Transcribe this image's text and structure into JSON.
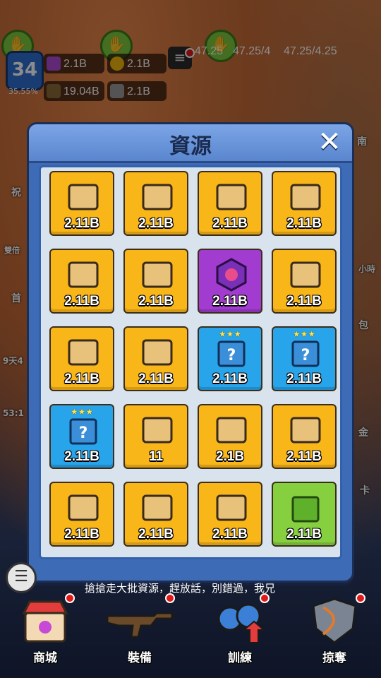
{
  "hud": {
    "level": "34",
    "level_percent": "35.55%",
    "resources": [
      {
        "icon": "gem-icon",
        "value": "2.1B"
      },
      {
        "icon": "gold-coin-icon",
        "value": "2.1B"
      },
      {
        "icon": "wood-log-icon",
        "value": "19.04B"
      },
      {
        "icon": "stone-icon",
        "value": "2.1B"
      }
    ],
    "counters": [
      "47.25",
      "47.25/4",
      "47.25/4.25"
    ]
  },
  "side_labels": {
    "left": [
      "祝",
      "雙倍",
      "首",
      "9天4",
      "53:1"
    ],
    "right": [
      "南",
      "小時",
      "包",
      "金",
      "卡"
    ]
  },
  "modal": {
    "title": "資源",
    "close_label": "✕",
    "items": [
      {
        "name": "ticket-u-icon",
        "color": "yellow",
        "value": "2.11B",
        "stars": ""
      },
      {
        "name": "ticket-infinity-icon",
        "color": "yellow",
        "value": "2.11B",
        "stars": ""
      },
      {
        "name": "ticket-boss-icon",
        "color": "yellow",
        "value": "2.11B",
        "stars": ""
      },
      {
        "name": "ticket-purple-icon",
        "color": "yellow",
        "value": "2.11B",
        "stars": ""
      },
      {
        "name": "teal-shells-icon",
        "color": "yellow",
        "value": "2.11B",
        "stars": ""
      },
      {
        "name": "ticket-teal-icon",
        "color": "yellow",
        "value": "2.11B",
        "stars": ""
      },
      {
        "name": "purple-skull-badge-icon",
        "color": "purple",
        "value": "2.11B",
        "stars": ""
      },
      {
        "name": "red-gold-emblem-icon",
        "color": "yellow",
        "value": "2.11B",
        "stars": ""
      },
      {
        "name": "purple-shells-icon",
        "color": "yellow",
        "value": "2.11B",
        "stars": ""
      },
      {
        "name": "crystal-shard-icon",
        "color": "yellow",
        "value": "2.11B",
        "stars": ""
      },
      {
        "name": "mystery-hero-card-icon",
        "color": "blue",
        "value": "2.11B",
        "stars": "★★★"
      },
      {
        "name": "mystery-green-card-icon",
        "color": "blue",
        "value": "2.11B",
        "stars": "★★★"
      },
      {
        "name": "mystery-blue-card-icon",
        "color": "blue",
        "value": "2.11B",
        "stars": "★★★"
      },
      {
        "name": "silver-map-fragment-icon",
        "color": "yellow",
        "value": "11",
        "stars": ""
      },
      {
        "name": "purple-paw-coin-icon",
        "color": "yellow",
        "value": "2.1B",
        "stars": ""
      },
      {
        "name": "red-skull-ticket-icon",
        "color": "yellow",
        "value": "2.11B",
        "stars": ""
      },
      {
        "name": "teal-canister-icon",
        "color": "yellow",
        "value": "2.11B",
        "stars": ""
      },
      {
        "name": "purple-canister-icon",
        "color": "yellow",
        "value": "2.11B",
        "stars": ""
      },
      {
        "name": "red-m-coin-icon",
        "color": "yellow",
        "value": "2.11B",
        "stars": ""
      },
      {
        "name": "green-mask-ticket-icon",
        "color": "green",
        "value": "2.11B",
        "stars": ""
      }
    ]
  },
  "ticker_text": "搶搶走大批資源，趕放話，別錯過，我兄",
  "bottom_nav": [
    {
      "name": "nav-shop",
      "label": "商城"
    },
    {
      "name": "nav-equipment",
      "label": "裝備"
    },
    {
      "name": "nav-training",
      "label": "訓練"
    },
    {
      "name": "nav-plunder",
      "label": "掠奪"
    }
  ],
  "colors": {
    "modal_bg": "#3e6bb6",
    "tile_yellow": "#f9b619",
    "tile_purple": "#a23bd0",
    "tile_blue": "#28a4ea",
    "tile_green": "#86d040"
  }
}
